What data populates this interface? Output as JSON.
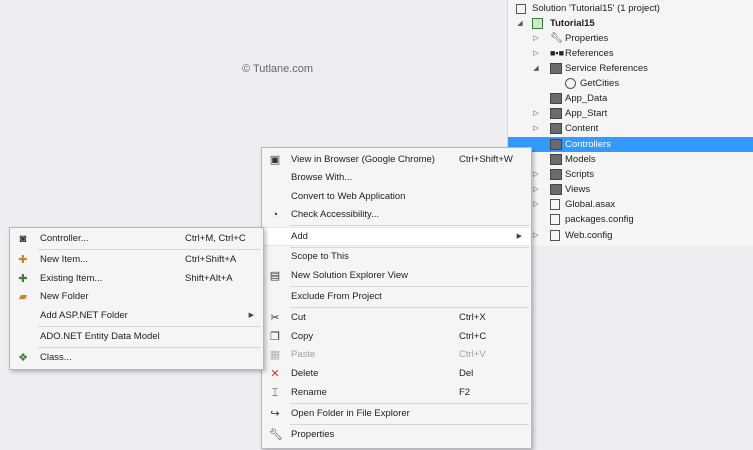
{
  "watermark": "© Tutlane.com",
  "solution": {
    "root_label": "Solution 'Tutorial15' (1 project)",
    "project_label": "Tutorial15",
    "items": [
      {
        "label": "Properties"
      },
      {
        "label": "References"
      },
      {
        "label": "Service References"
      },
      {
        "label": "GetCities"
      },
      {
        "label": "App_Data"
      },
      {
        "label": "App_Start"
      },
      {
        "label": "Content"
      },
      {
        "label": "Controllers"
      },
      {
        "label": "Models"
      },
      {
        "label": "Scripts"
      },
      {
        "label": "Views"
      },
      {
        "label": "Global.asax"
      },
      {
        "label": "packages.config"
      },
      {
        "label": "Web.config"
      }
    ],
    "selection_color": "#3399ff"
  },
  "context_menu": {
    "items": [
      {
        "label": "View in Browser (Google Chrome)",
        "shortcut": "Ctrl+Shift+W",
        "icon": "browser-icon"
      },
      {
        "label": "Browse With...",
        "shortcut": ""
      },
      {
        "label": "Convert to Web Application",
        "shortcut": ""
      },
      {
        "label": "Check Accessibility...",
        "shortcut": "",
        "icon": "accessibility-icon"
      },
      {
        "label": "Add",
        "shortcut": ""
      },
      {
        "label": "Scope to This",
        "shortcut": ""
      },
      {
        "label": "New Solution Explorer View",
        "shortcut": "",
        "icon": "new-view-icon"
      },
      {
        "label": "Exclude From Project",
        "shortcut": ""
      },
      {
        "label": "Cut",
        "shortcut": "Ctrl+X",
        "icon": "cut-icon"
      },
      {
        "label": "Copy",
        "shortcut": "Ctrl+C",
        "icon": "copy-icon"
      },
      {
        "label": "Paste",
        "shortcut": "Ctrl+V",
        "icon": "paste-icon"
      },
      {
        "label": "Delete",
        "shortcut": "Del",
        "icon": "delete-icon"
      },
      {
        "label": "Rename",
        "shortcut": "F2",
        "icon": "rename-icon"
      },
      {
        "label": "Open Folder in File Explorer",
        "shortcut": "",
        "icon": "open-folder-icon"
      },
      {
        "label": "Properties",
        "shortcut": "",
        "icon": "wrench-icon"
      }
    ]
  },
  "add_submenu": {
    "items": [
      {
        "label": "Controller...",
        "shortcut": "Ctrl+M, Ctrl+C"
      },
      {
        "label": "New Item...",
        "shortcut": "Ctrl+Shift+A"
      },
      {
        "label": "Existing Item...",
        "shortcut": "Shift+Alt+A"
      },
      {
        "label": "New Folder",
        "shortcut": ""
      },
      {
        "label": "Add ASP.NET Folder",
        "shortcut": ""
      },
      {
        "label": "ADO.NET Entity Data Model",
        "shortcut": ""
      },
      {
        "label": "Class...",
        "shortcut": ""
      }
    ]
  }
}
